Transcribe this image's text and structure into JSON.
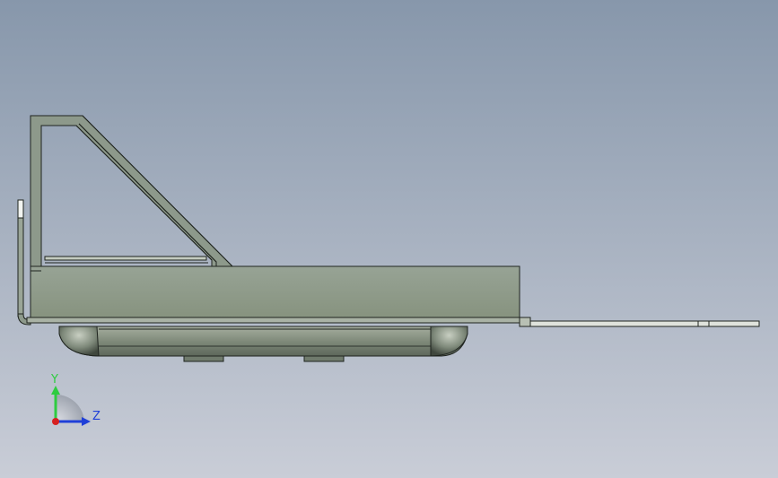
{
  "viewport": {
    "background_top": "#8797ab",
    "background_bottom": "#c8ccd6"
  },
  "part": {
    "body_color": "#8d998b",
    "dark_color": "#5e6a5c",
    "edge_color": "#1f241f",
    "highlight_color": "#e8ece6"
  },
  "triad": {
    "y_label": "Y",
    "z_label": "Z",
    "y_color": "#2ecc40",
    "z_color": "#1f3fd8",
    "x_color": "#d62020"
  }
}
